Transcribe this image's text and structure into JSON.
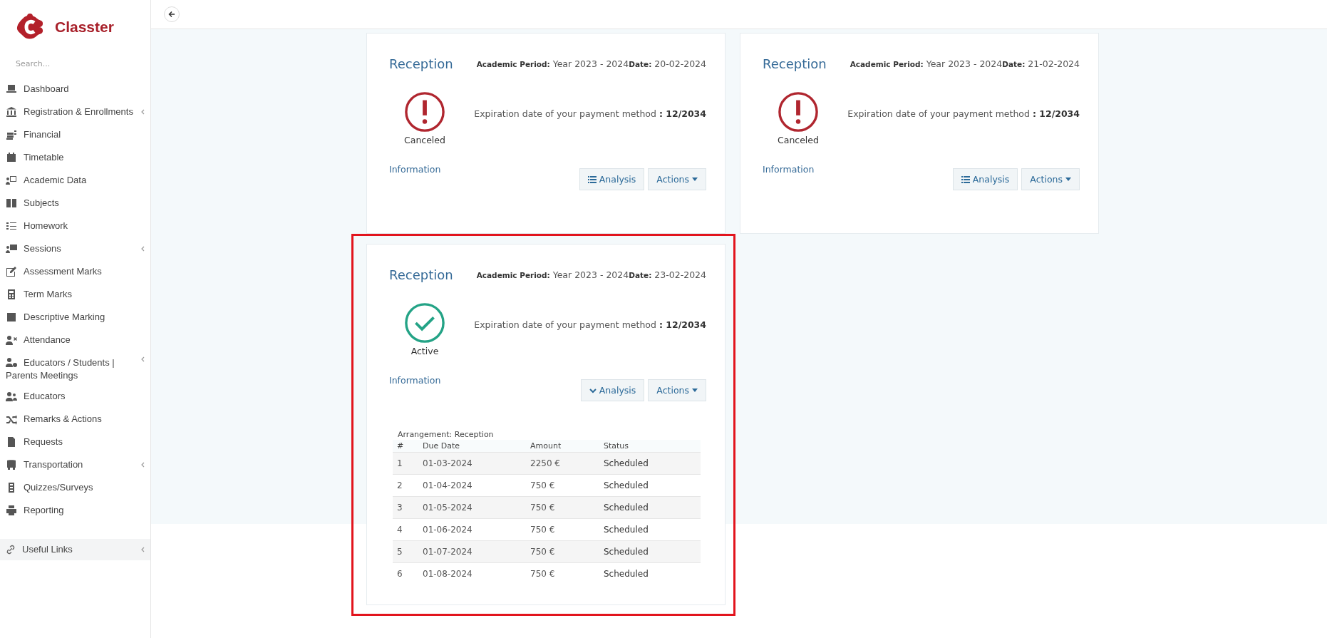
{
  "sidebar": {
    "logo_text": "Classter",
    "search": {
      "placeholder": "Search..."
    },
    "items": [
      {
        "label": "Dashboard",
        "expandable": false
      },
      {
        "label": "Registration & Enrollments",
        "expandable": true
      },
      {
        "label": "Financial",
        "expandable": false
      },
      {
        "label": "Timetable",
        "expandable": false
      },
      {
        "label": "Academic Data",
        "expandable": false
      },
      {
        "label": "Subjects",
        "expandable": false
      },
      {
        "label": "Homework",
        "expandable": false
      },
      {
        "label": "Sessions",
        "expandable": true
      },
      {
        "label": "Assessment Marks",
        "expandable": false
      },
      {
        "label": "Term Marks",
        "expandable": false
      },
      {
        "label": "Descriptive Marking",
        "expandable": false
      },
      {
        "label": "Attendance",
        "expandable": false
      },
      {
        "label": "Educators / Students | Parents Meetings",
        "expandable": true
      },
      {
        "label": "Educators",
        "expandable": false
      },
      {
        "label": "Remarks & Actions",
        "expandable": false
      },
      {
        "label": "Requests",
        "expandable": false
      },
      {
        "label": "Transportation",
        "expandable": true
      },
      {
        "label": "Quizzes/Surveys",
        "expandable": false
      },
      {
        "label": "Reporting",
        "expandable": false
      }
    ],
    "footer_item": {
      "label": "Useful Links",
      "expandable": true
    }
  },
  "cards": [
    {
      "title": "Reception",
      "meta": "**Academic Period:** Year 2023 - 2024**Date:** 20-02-2024",
      "status": {
        "kind": "canceled",
        "label": "Canceled"
      },
      "expiration": "Expiration date of your payment method **: 12/2034**",
      "info_link": "Information",
      "analysis": {
        "label": "Analysis",
        "expanded": false
      },
      "actions_label": "Actions",
      "highlighted": false
    },
    {
      "title": "Reception",
      "meta": "**Academic Period:** Year 2023 - 2024**Date:** 21-02-2024",
      "status": {
        "kind": "canceled",
        "label": "Canceled"
      },
      "expiration": "Expiration date of your payment method **: 12/2034**",
      "info_link": "Information",
      "analysis": {
        "label": "Analysis",
        "expanded": false
      },
      "actions_label": "Actions",
      "highlighted": false
    },
    {
      "title": "Reception",
      "meta": "**Academic Period:** Year 2023 - 2024**Date:** 23-02-2024",
      "status": {
        "kind": "active",
        "label": "Active"
      },
      "expiration": "Expiration date of your payment method **: 12/2034**",
      "info_link": "Information",
      "analysis": {
        "label": "Analysis",
        "expanded": true
      },
      "actions_label": "Actions",
      "highlighted": true,
      "schedule": {
        "caption": "Arrangement: Reception",
        "columns": [
          "#",
          "Due Date",
          "Amount",
          "Status"
        ],
        "rows": [
          [
            "1",
            "01-03-2024",
            "2250 €",
            "Scheduled"
          ],
          [
            "2",
            "01-04-2024",
            "750 €",
            "Scheduled"
          ],
          [
            "3",
            "01-05-2024",
            "750 €",
            "Scheduled"
          ],
          [
            "4",
            "01-06-2024",
            "750 €",
            "Scheduled"
          ],
          [
            "5",
            "01-07-2024",
            "750 €",
            "Scheduled"
          ],
          [
            "6",
            "01-08-2024",
            "750 €",
            "Scheduled"
          ]
        ]
      }
    }
  ]
}
